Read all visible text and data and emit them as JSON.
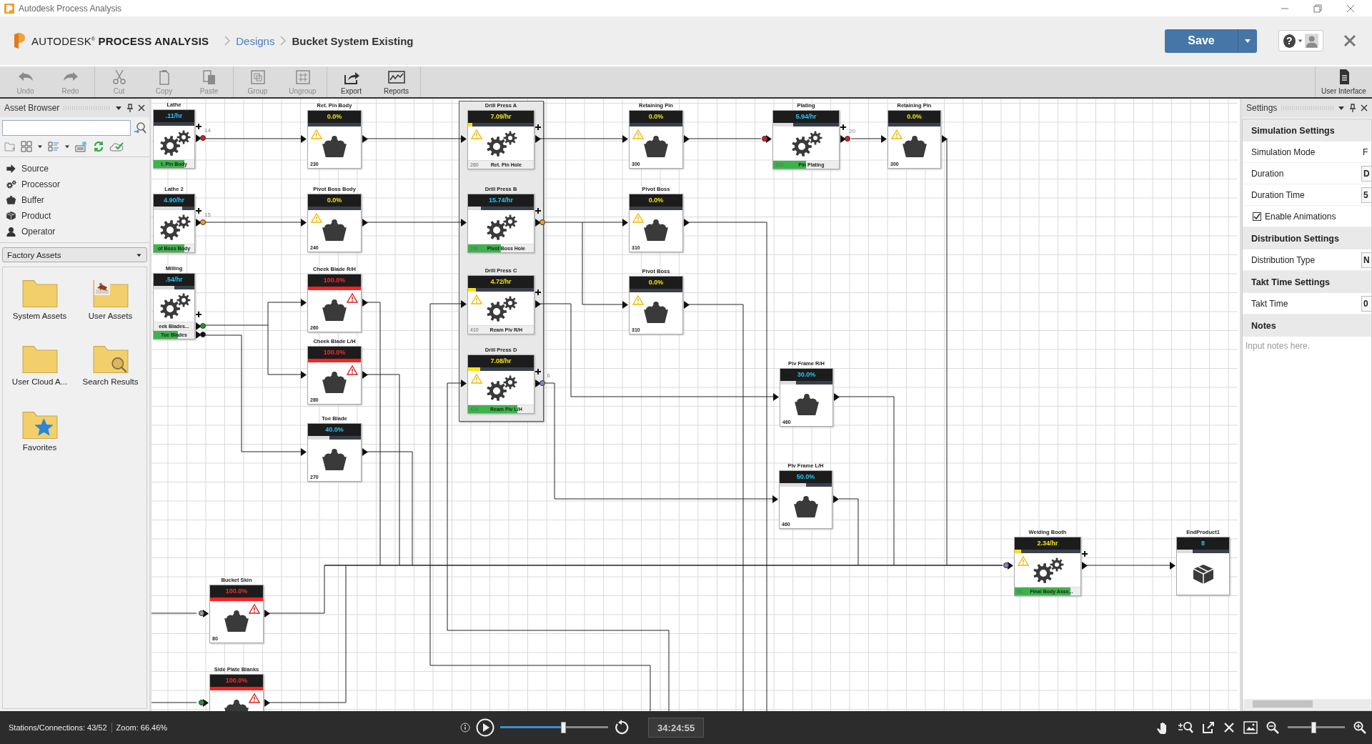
{
  "window": {
    "title": "Autodesk Process Analysis"
  },
  "header": {
    "brand": "AUTODESK$^{®}$ **PROCESS ANALYSIS**",
    "breadcrumbs": [
      {
        "label": "Designs",
        "kind": "link"
      },
      {
        "label": "Bucket System Existing",
        "kind": "current"
      }
    ],
    "save_button": "Save",
    "help_button": "?"
  },
  "toolbar": [
    {
      "items": [
        {
          "label": "Undo",
          "kind": "undo",
          "disabled": true
        },
        {
          "label": "Redo",
          "kind": "redo",
          "disabled": true
        }
      ]
    },
    {
      "items": [
        {
          "label": "Cut",
          "kind": "cut",
          "disabled": true
        },
        {
          "label": "Copy",
          "kind": "copy",
          "disabled": true
        },
        {
          "label": "Paste",
          "kind": "paste",
          "disabled": true
        }
      ]
    },
    {
      "items": [
        {
          "label": "Group",
          "kind": "group",
          "disabled": true
        },
        {
          "label": "Ungroup",
          "kind": "ungroup",
          "disabled": true
        }
      ]
    },
    {
      "items": [
        {
          "label": "Export",
          "kind": "export",
          "disabled": false
        },
        {
          "label": "Reports",
          "kind": "reports",
          "disabled": false
        }
      ]
    }
  ],
  "toolbar_right": {
    "label": "User Interface",
    "kind": "document"
  },
  "asset_browser": {
    "title": "Asset Browser",
    "categories": [
      {
        "label": "Source",
        "kind": "source"
      },
      {
        "label": "Processor",
        "kind": "processor"
      },
      {
        "label": "Buffer",
        "kind": "buffer"
      },
      {
        "label": "Product",
        "kind": "product"
      },
      {
        "label": "Operator",
        "kind": "operator"
      }
    ],
    "library": "Factory Assets",
    "folders": [
      {
        "label": "System Assets",
        "kind": "plain"
      },
      {
        "label": "User Assets",
        "kind": "thumbnail"
      },
      {
        "label": "User Cloud A...",
        "kind": "plain"
      },
      {
        "label": "Search Results",
        "kind": "search"
      },
      {
        "label": "Favorites",
        "kind": "star"
      }
    ]
  },
  "canvas": {
    "nodes": [
      {
        "kind": "processor",
        "title": "Lathe",
        "value": ".11/hr",
        "warning": false,
        "full": false,
        "level": 0,
        "outputs": [
          {
            "product": "t. Pin Body",
            "level": 0.75
          }
        ],
        "ports": [
          {
            "kind": "out",
            "color": "#d81e1e",
            "label": "14"
          }
        ]
      },
      {
        "kind": "processor",
        "title": "Lathe 2",
        "value": "4.90/hr",
        "warning": false,
        "full": false,
        "level": 0.7,
        "outputs": [
          {
            "product": "ot Boss Body",
            "level": 0.75
          }
        ],
        "ports": [
          {
            "kind": "out",
            "color": "#f39c33",
            "label": "15"
          }
        ]
      },
      {
        "kind": "processor",
        "title": "Milling",
        "value": ".54/hr",
        "warning": false,
        "full": false,
        "level": 0.5,
        "outputs": [
          {
            "product": "eek Blades...",
            "level": 0
          },
          {
            "product": "Toe Blades",
            "level": 0.6
          }
        ],
        "ports": [
          {
            "kind": "out",
            "color": "#1f9a2a"
          },
          {
            "kind": "out",
            "color": "#111111"
          }
        ]
      },
      {
        "kind": "buffer",
        "title": "Ret. Pin Body",
        "value": "0.0%",
        "warning": true,
        "full": false,
        "level": 0,
        "count": "230"
      },
      {
        "kind": "buffer",
        "title": "Pivot Boss Body",
        "value": "0.0%",
        "warning": true,
        "full": false,
        "level": 0,
        "count": "240"
      },
      {
        "kind": "buffer",
        "title": "Cheek Blade R/H",
        "value": "100.0%",
        "warning": false,
        "full": true,
        "level": 1,
        "count": "260"
      },
      {
        "kind": "buffer",
        "title": "Cheek Blade L/H",
        "value": "100.0%",
        "warning": false,
        "full": true,
        "level": 1,
        "count": "280"
      },
      {
        "kind": "buffer",
        "title": "Toe Blade",
        "value": "40.0%",
        "warning": false,
        "full": false,
        "level": 0.4,
        "count": "270"
      },
      {
        "kind": "processor",
        "title": "Drill Press A",
        "value": "7.09/hr",
        "warning": true,
        "full": false,
        "level": 0.07,
        "outputs": [
          {
            "count": "280",
            "product": "Ret. Pin Hole",
            "level": 0
          }
        ]
      },
      {
        "kind": "processor",
        "title": "Drill Press B",
        "value": "15.74/hr",
        "warning": false,
        "full": false,
        "level": 0.2,
        "outputs": [
          {
            "count": "290",
            "product": "Pivot Boss Hole",
            "level": 0.5
          }
        ],
        "ports": [
          {
            "kind": "out",
            "color": "#f39c33"
          }
        ]
      },
      {
        "kind": "processor",
        "title": "Drill Press C",
        "value": "4.72/hr",
        "warning": true,
        "full": false,
        "level": 0.12,
        "outputs": [
          {
            "count": "410",
            "product": "Ream Piv R/H",
            "level": 0
          }
        ]
      },
      {
        "kind": "processor",
        "title": "Drill Press D",
        "value": "7.08/hr",
        "warning": true,
        "full": false,
        "level": 0.18,
        "outputs": [
          {
            "count": "420",
            "product": "Ream Piv L/H",
            "level": 0.75
          }
        ],
        "ports": [
          {
            "kind": "out",
            "color": "#8a7fc8",
            "label": "6"
          }
        ]
      },
      {
        "kind": "buffer",
        "title": "Retaining Pin",
        "value": "0.0%",
        "warning": true,
        "full": false,
        "level": 0,
        "count": "300"
      },
      {
        "kind": "buffer",
        "title": "Pivot Boss",
        "value": "0.0%",
        "warning": true,
        "full": false,
        "level": 0,
        "count": "310"
      },
      {
        "kind": "buffer",
        "title": "Pivot Boss",
        "value": "0.0%",
        "warning": true,
        "full": false,
        "level": 0,
        "count": "310"
      },
      {
        "kind": "processor",
        "title": "Plating",
        "value": "5.94/hr",
        "warning": false,
        "full": false,
        "level": 0.3,
        "outputs": [
          {
            "count": "320",
            "product": "Pin Plating",
            "level": 0.5
          }
        ],
        "ports": [
          {
            "kind": "in",
            "color": "#d81e1e"
          },
          {
            "kind": "out",
            "color": "#d81e1e",
            "label": "20"
          }
        ]
      },
      {
        "kind": "buffer",
        "title": "Retaining Pin",
        "value": "0.0%",
        "warning": true,
        "full": false,
        "level": 0,
        "count": "300"
      },
      {
        "kind": "buffer",
        "title": "Piv Frame R/H",
        "value": "30.0%",
        "warning": false,
        "full": false,
        "level": 0.3,
        "count": "460"
      },
      {
        "kind": "buffer",
        "title": "Piv Frame L/H",
        "value": "50.0%",
        "warning": false,
        "full": false,
        "level": 0.5,
        "count": "460"
      },
      {
        "kind": "buffer",
        "title": "Bucket Skin",
        "value": "100.0%",
        "warning": false,
        "full": true,
        "level": 1,
        "count": "80",
        "ports": [
          {
            "kind": "in",
            "color": "#9a9a9a"
          }
        ]
      },
      {
        "kind": "buffer",
        "title": "Side Plate Blanks",
        "value": "100.0%",
        "warning": false,
        "full": true,
        "level": 1,
        "ports": [
          {
            "kind": "in",
            "color": "#1f9a2a"
          }
        ]
      },
      {
        "kind": "processor",
        "title": "Welding Booth",
        "value": "2.34/hr",
        "warning": true,
        "full": false,
        "level": 0.1,
        "outputs": [
          {
            "count": "90",
            "product": "Final Body Asse...",
            "level": 0.85
          }
        ],
        "ports": [
          {
            "kind": "in",
            "color": "#8a7fc8"
          }
        ]
      },
      {
        "kind": "product",
        "title": "EndProduct1",
        "value": "8",
        "warning": false,
        "full": false,
        "level": 0.3
      }
    ]
  },
  "settings": {
    "title": "Settings",
    "sections": [
      {
        "title": "Simulation Settings",
        "rows": [
          {
            "kind": "text",
            "label": "Simulation Mode",
            "value": "F"
          },
          {
            "kind": "dropdown",
            "label": "Duration",
            "value": "D"
          },
          {
            "kind": "input",
            "label": "Duration Time",
            "value": "5"
          },
          {
            "kind": "checkbox",
            "label": "Enable Animations",
            "checked": true
          }
        ]
      },
      {
        "title": "Distribution Settings",
        "rows": [
          {
            "kind": "dropdown",
            "label": "Distribution Type",
            "value": "N"
          }
        ]
      },
      {
        "title": "Takt Time Settings",
        "rows": [
          {
            "kind": "input",
            "label": "Takt Time",
            "value": "0"
          }
        ]
      },
      {
        "title": "Notes",
        "placeholder": "Input notes here."
      }
    ]
  },
  "status_bar": {
    "stations": "Stations/Connections: 43/52",
    "zoom": "Zoom: 66.46%",
    "playback": {
      "level": 0.58
    },
    "time": "34:24:55",
    "zoom_slider": {
      "level": 0.45
    }
  }
}
